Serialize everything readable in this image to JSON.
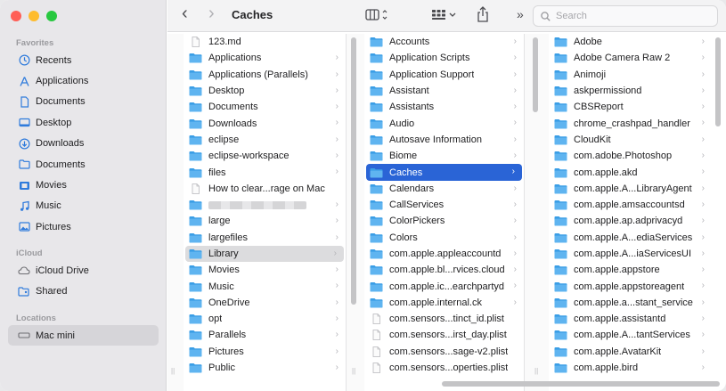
{
  "window": {
    "title": "Caches"
  },
  "toolbar": {
    "back_glyph": "‹",
    "forward_glyph": "›",
    "more_glyph": "»",
    "search_placeholder": "Search"
  },
  "sidebar": {
    "favorites_heading": "Favorites",
    "favorites": [
      {
        "label": "Recents",
        "icon": "clock-icon"
      },
      {
        "label": "Applications",
        "icon": "applications-icon"
      },
      {
        "label": "Documents",
        "icon": "document-icon"
      },
      {
        "label": "Desktop",
        "icon": "desktop-icon"
      },
      {
        "label": "Downloads",
        "icon": "download-icon"
      },
      {
        "label": "Documents",
        "icon": "folder-icon"
      },
      {
        "label": "Movies",
        "icon": "film-icon"
      },
      {
        "label": "Music",
        "icon": "music-note-icon"
      },
      {
        "label": "Pictures",
        "icon": "photo-icon"
      }
    ],
    "icloud_heading": "iCloud",
    "icloud": [
      {
        "label": "iCloud Drive",
        "icon": "cloud-icon"
      },
      {
        "label": "Shared",
        "icon": "shared-folder-icon"
      }
    ],
    "locations_heading": "Locations",
    "locations": [
      {
        "label": "Mac mini",
        "icon": "mac-mini-icon"
      }
    ]
  },
  "columns": {
    "col1": [
      {
        "name": "123.md",
        "kind": "file"
      },
      {
        "name": "Applications",
        "kind": "folder"
      },
      {
        "name": "Applications (Parallels)",
        "kind": "folder"
      },
      {
        "name": "Desktop",
        "kind": "folder"
      },
      {
        "name": "Documents",
        "kind": "folder"
      },
      {
        "name": "Downloads",
        "kind": "folder"
      },
      {
        "name": "eclipse",
        "kind": "folder"
      },
      {
        "name": "eclipse-workspace",
        "kind": "folder"
      },
      {
        "name": "files",
        "kind": "folder"
      },
      {
        "name": "How to clear...rage on Mac",
        "kind": "file"
      },
      {
        "name": "",
        "kind": "folder",
        "redacted": true
      },
      {
        "name": "large",
        "kind": "folder"
      },
      {
        "name": "largefiles",
        "kind": "folder"
      },
      {
        "name": "Library",
        "kind": "folder",
        "selected": "gray"
      },
      {
        "name": "Movies",
        "kind": "folder"
      },
      {
        "name": "Music",
        "kind": "folder"
      },
      {
        "name": "OneDrive",
        "kind": "folder"
      },
      {
        "name": "opt",
        "kind": "folder"
      },
      {
        "name": "Parallels",
        "kind": "folder"
      },
      {
        "name": "Pictures",
        "kind": "folder"
      },
      {
        "name": "Public",
        "kind": "folder"
      }
    ],
    "col2": [
      {
        "name": "Accounts",
        "kind": "folder"
      },
      {
        "name": "Application Scripts",
        "kind": "folder"
      },
      {
        "name": "Application Support",
        "kind": "folder"
      },
      {
        "name": "Assistant",
        "kind": "folder"
      },
      {
        "name": "Assistants",
        "kind": "folder"
      },
      {
        "name": "Audio",
        "kind": "folder"
      },
      {
        "name": "Autosave Information",
        "kind": "folder"
      },
      {
        "name": "Biome",
        "kind": "folder"
      },
      {
        "name": "Caches",
        "kind": "folder",
        "selected": "blue"
      },
      {
        "name": "Calendars",
        "kind": "folder"
      },
      {
        "name": "CallServices",
        "kind": "folder"
      },
      {
        "name": "ColorPickers",
        "kind": "folder"
      },
      {
        "name": "Colors",
        "kind": "folder"
      },
      {
        "name": "com.apple.appleaccountd",
        "kind": "folder"
      },
      {
        "name": "com.apple.bl...rvices.cloud",
        "kind": "folder"
      },
      {
        "name": "com.apple.ic...earchpartyd",
        "kind": "folder"
      },
      {
        "name": "com.apple.internal.ck",
        "kind": "folder"
      },
      {
        "name": "com.sensors...tinct_id.plist",
        "kind": "file"
      },
      {
        "name": "com.sensors...irst_day.plist",
        "kind": "file"
      },
      {
        "name": "com.sensors...sage-v2.plist",
        "kind": "file"
      },
      {
        "name": "com.sensors...operties.plist",
        "kind": "file"
      }
    ],
    "col3": [
      {
        "name": "Adobe",
        "kind": "folder"
      },
      {
        "name": "Adobe Camera Raw 2",
        "kind": "folder"
      },
      {
        "name": "Animoji",
        "kind": "folder"
      },
      {
        "name": "askpermissiond",
        "kind": "folder"
      },
      {
        "name": "CBSReport",
        "kind": "folder"
      },
      {
        "name": "chrome_crashpad_handler",
        "kind": "folder"
      },
      {
        "name": "CloudKit",
        "kind": "folder"
      },
      {
        "name": "com.adobe.Photoshop",
        "kind": "folder"
      },
      {
        "name": "com.apple.akd",
        "kind": "folder"
      },
      {
        "name": "com.apple.A...LibraryAgent",
        "kind": "folder"
      },
      {
        "name": "com.apple.amsaccountsd",
        "kind": "folder"
      },
      {
        "name": "com.apple.ap.adprivacyd",
        "kind": "folder"
      },
      {
        "name": "com.apple.A...ediaServices",
        "kind": "folder"
      },
      {
        "name": "com.apple.A...iaServicesUI",
        "kind": "folder"
      },
      {
        "name": "com.apple.appstore",
        "kind": "folder"
      },
      {
        "name": "com.apple.appstoreagent",
        "kind": "folder"
      },
      {
        "name": "com.apple.a...stant_service",
        "kind": "folder"
      },
      {
        "name": "com.apple.assistantd",
        "kind": "folder"
      },
      {
        "name": "com.apple.A...tantServices",
        "kind": "folder"
      },
      {
        "name": "com.apple.AvatarKit",
        "kind": "folder"
      },
      {
        "name": "com.apple.bird",
        "kind": "folder"
      }
    ]
  },
  "colors": {
    "selection_blue": "#2a64d6",
    "folder_blue": "#3a9ee6",
    "sidebar_icon": "#2f7bdc"
  }
}
